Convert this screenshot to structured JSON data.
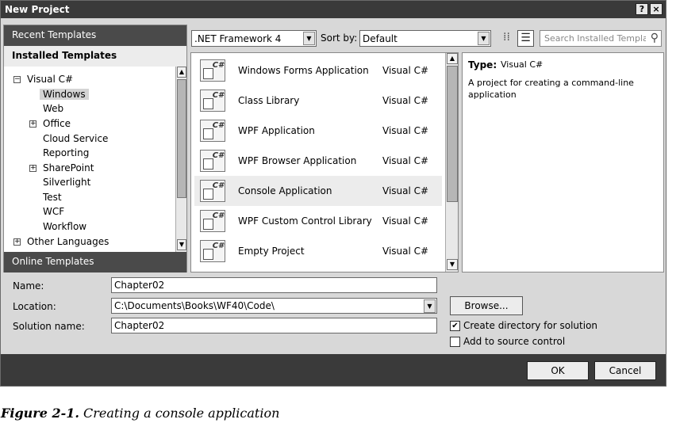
{
  "window": {
    "title": "New Project",
    "help_label": "?",
    "close_label": "×"
  },
  "nav": {
    "recent": "Recent Templates",
    "installed": "Installed Templates",
    "online": "Online Templates",
    "tree": [
      {
        "label": "Visual C#",
        "expander": "−"
      },
      {
        "label": "Windows",
        "selected": true
      },
      {
        "label": "Web"
      },
      {
        "label": "Office",
        "expander": "+"
      },
      {
        "label": "Cloud Service"
      },
      {
        "label": "Reporting"
      },
      {
        "label": "SharePoint",
        "expander": "+"
      },
      {
        "label": "Silverlight"
      },
      {
        "label": "Test"
      },
      {
        "label": "WCF"
      },
      {
        "label": "Workflow"
      },
      {
        "label": "Other Languages",
        "expander": "+"
      }
    ]
  },
  "toolbar": {
    "framework": ".NET Framework 4",
    "sort_label": "Sort by:",
    "sort_value": "Default",
    "search_placeholder": "Search Installed Templat"
  },
  "templates": [
    {
      "name": "Windows Forms Application",
      "lang": "Visual C#"
    },
    {
      "name": "Class Library",
      "lang": "Visual C#"
    },
    {
      "name": "WPF Application",
      "lang": "Visual C#"
    },
    {
      "name": "WPF Browser Application",
      "lang": "Visual C#"
    },
    {
      "name": "Console Application",
      "lang": "Visual C#",
      "selected": true
    },
    {
      "name": "WPF Custom Control Library",
      "lang": "Visual C#"
    },
    {
      "name": "Empty Project",
      "lang": "Visual C#"
    }
  ],
  "description": {
    "type_label": "Type:",
    "type_value": "Visual C#",
    "text": "A project for creating a command-line application"
  },
  "form": {
    "name_label": "Name:",
    "name_value": "Chapter02",
    "location_label": "Location:",
    "location_value": "C:\\Documents\\Books\\WF40\\Code\\",
    "solution_label": "Solution name:",
    "solution_value": "Chapter02",
    "browse": "Browse...",
    "create_dir_label": "Create directory for solution",
    "create_dir_checked": true,
    "source_control_label": "Add to source control",
    "source_control_checked": false
  },
  "buttons": {
    "ok": "OK",
    "cancel": "Cancel"
  },
  "caption": {
    "number": "Figure 2-1.",
    "text": "Creating a console application"
  }
}
